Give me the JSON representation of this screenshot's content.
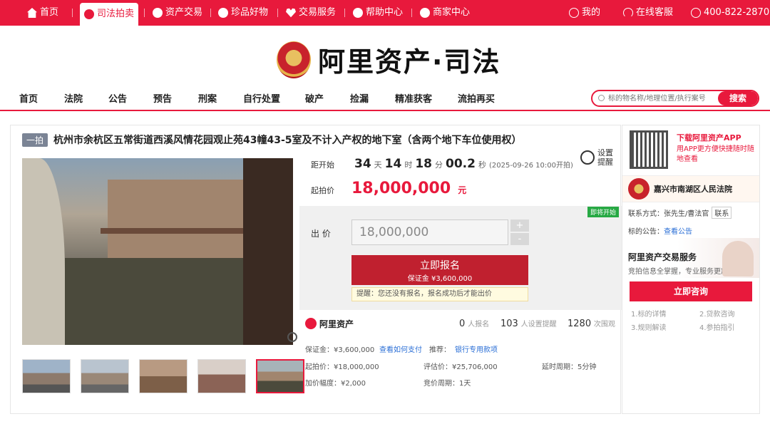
{
  "topbar": {
    "items": [
      {
        "label": "首页",
        "icon": "home-icon"
      },
      {
        "label": "司法拍卖",
        "icon": "gavel-icon"
      },
      {
        "label": "资产交易",
        "icon": "asset-icon"
      },
      {
        "label": "珍品好物",
        "icon": "gem-icon"
      },
      {
        "label": "交易服务",
        "icon": "heart-icon"
      },
      {
        "label": "帮助中心",
        "icon": "help-icon"
      },
      {
        "label": "商家中心",
        "icon": "store-icon"
      }
    ],
    "right": [
      {
        "label": "我的",
        "icon": "user-icon"
      },
      {
        "label": "在线客服",
        "icon": "headset-icon"
      },
      {
        "label": "400-822-2870",
        "icon": "phone-icon"
      }
    ]
  },
  "brand": {
    "title": "阿里资产·司法"
  },
  "nav": {
    "items": [
      "首页",
      "法院",
      "公告",
      "预告",
      "刑案",
      "自行处置",
      "破产",
      "捡漏",
      "精准获客",
      "流拍再买"
    ],
    "search_placeholder": "标的物名称/地理位置/执行案号",
    "search_button": "搜索"
  },
  "item": {
    "tag": "一拍",
    "title": "杭州市余杭区五常街道西溪风情花园观止苑43幢43-5室及不计入产权的地下室（含两个地下车位使用权）",
    "countdown_label": "距开始",
    "days": "34",
    "days_unit": "天",
    "hours": "14",
    "hours_unit": "时",
    "minutes": "18",
    "minutes_unit": "分",
    "seconds": "00.2",
    "seconds_unit": "秒",
    "start_time": "(2025-09-26 10:00开拍)",
    "remind_line1": "设置",
    "remind_line2": "提醒",
    "start_price_label": "起拍价",
    "start_price": "18,000,000",
    "start_price_unit": "元"
  },
  "bid": {
    "badge": "即将开始",
    "label": "出 价",
    "value": "18,000,000",
    "plus": "+",
    "minus": "-",
    "signup": "立即报名",
    "deposit": "保证金 ¥3,600,000",
    "hint": "提醒：您还没有报名，报名成功后才能出价"
  },
  "stats": {
    "brand": "阿里资产",
    "signups": "0",
    "signups_label": "人报名",
    "reminders": "103",
    "reminders_label": "人设置提醒",
    "views": "1280",
    "views_label": "次围观"
  },
  "details": {
    "deposit": "保证金：¥3,600,000",
    "pay_link": "查看如何支付",
    "recommend": "推荐：",
    "bank_link": "银行专用款项",
    "start_price": "起拍价：¥18,000,000",
    "appraisal": "评估价：¥25,706,000",
    "delay": "延时周期：5分钟",
    "increment": "加价幅度：¥2,000",
    "cycle": "竞价周期：1天"
  },
  "side": {
    "app_title": "下载阿里资产APP",
    "app_desc": "用APP更方便快捷随时随地查看",
    "court": "嘉兴市南湖区人民法院",
    "contact_label": "联系方式：张先生/曹法官",
    "contact_button": "联系",
    "notice_label": "标的公告：",
    "notice_link": "查看公告",
    "promo_title": "阿里资产交易服务",
    "promo_desc": "竞拍信息全掌握，专业服务更放心",
    "consult_button": "立即咨询",
    "guides": [
      "1.标的详情",
      "2.贷款咨询",
      "3.规则解读",
      "4.参拍指引"
    ]
  },
  "colors": {
    "brand_red": "#e8193c",
    "signup_red": "#c0202f",
    "badge_green": "#27a944",
    "link_blue": "#2b6fd6"
  }
}
